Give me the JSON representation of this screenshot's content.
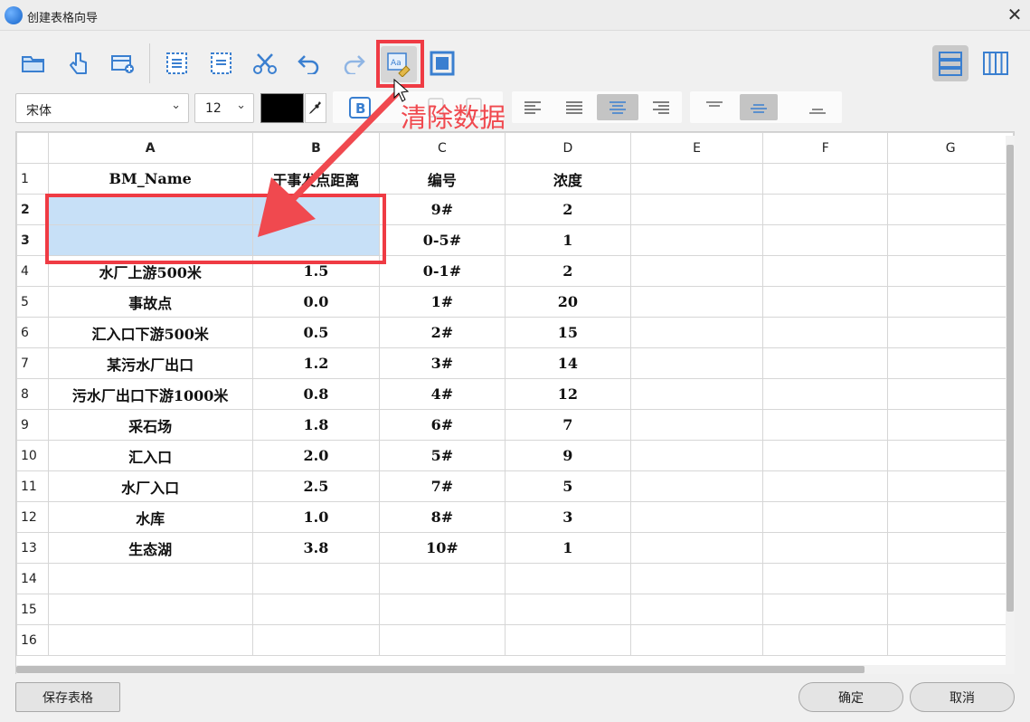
{
  "window": {
    "title": "创建表格向导",
    "close_glyph": "✕"
  },
  "toolbar": {
    "icons": [
      "folder-open-icon",
      "touch-hand-icon",
      "add-table-icon",
      "copy-icon",
      "paste-icon",
      "scissors-icon",
      "undo-icon",
      "redo-icon",
      "clear-data-icon",
      "select-all-icon"
    ],
    "layout_icons": [
      "row-layout-icon",
      "column-layout-icon"
    ]
  },
  "format": {
    "font": "宋体",
    "size": "12",
    "color": "#000000",
    "bold_label": "B"
  },
  "annotation": {
    "text": "清除数据",
    "color": "#f0494f"
  },
  "grid": {
    "columns": [
      "A",
      "B",
      "C",
      "D",
      "E",
      "F",
      "G"
    ],
    "rows": [
      {
        "n": "1",
        "cells": [
          "BM_Name",
          "于事发点距离",
          "编号",
          "浓度",
          "",
          "",
          ""
        ]
      },
      {
        "n": "2",
        "cells": [
          "",
          "",
          "9#",
          "2",
          "",
          "",
          ""
        ]
      },
      {
        "n": "3",
        "cells": [
          "",
          "",
          "0-5#",
          "1",
          "",
          "",
          ""
        ]
      },
      {
        "n": "4",
        "cells": [
          "水厂上游500米",
          "1.5",
          "0-1#",
          "2",
          "",
          "",
          ""
        ]
      },
      {
        "n": "5",
        "cells": [
          "事故点",
          "0.0",
          "1#",
          "20",
          "",
          "",
          ""
        ]
      },
      {
        "n": "6",
        "cells": [
          "汇入口下游500米",
          "0.5",
          "2#",
          "15",
          "",
          "",
          ""
        ]
      },
      {
        "n": "7",
        "cells": [
          "某污水厂出口",
          "1.2",
          "3#",
          "14",
          "",
          "",
          ""
        ]
      },
      {
        "n": "8",
        "cells": [
          "污水厂出口下游1000米",
          "0.8",
          "4#",
          "12",
          "",
          "",
          ""
        ]
      },
      {
        "n": "9",
        "cells": [
          "采石场",
          "1.8",
          "6#",
          "7",
          "",
          "",
          ""
        ]
      },
      {
        "n": "10",
        "cells": [
          "汇入口",
          "2.0",
          "5#",
          "9",
          "",
          "",
          ""
        ]
      },
      {
        "n": "11",
        "cells": [
          "水厂入口",
          "2.5",
          "7#",
          "5",
          "",
          "",
          ""
        ]
      },
      {
        "n": "12",
        "cells": [
          "水库",
          "1.0",
          "8#",
          "3",
          "",
          "",
          ""
        ]
      },
      {
        "n": "13",
        "cells": [
          "生态湖",
          "3.8",
          "10#",
          "1",
          "",
          "",
          ""
        ]
      },
      {
        "n": "14",
        "cells": [
          "",
          "",
          "",
          "",
          "",
          "",
          ""
        ]
      },
      {
        "n": "15",
        "cells": [
          "",
          "",
          "",
          "",
          "",
          "",
          ""
        ]
      },
      {
        "n": "16",
        "cells": [
          "",
          "",
          "",
          "",
          "",
          "",
          ""
        ]
      }
    ]
  },
  "buttons": {
    "save": "保存表格",
    "ok": "确定",
    "cancel": "取消"
  }
}
